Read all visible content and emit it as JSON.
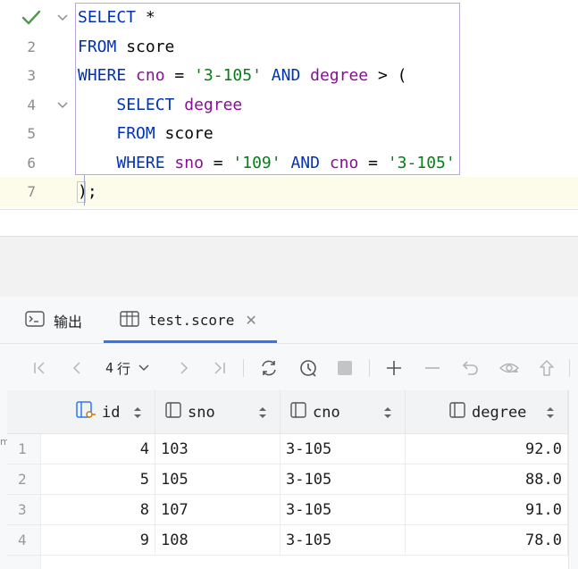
{
  "editor": {
    "line_numbers": [
      "",
      "2",
      "3",
      "4",
      "5",
      "6",
      "7"
    ],
    "lines": [
      [
        {
          "t": "SELECT",
          "c": "kw"
        },
        {
          "t": " *",
          "c": ""
        }
      ],
      [
        {
          "t": "FROM",
          "c": "kw"
        },
        {
          "t": " score",
          "c": ""
        }
      ],
      [
        {
          "t": "WHERE",
          "c": "kw"
        },
        {
          "t": " ",
          "c": ""
        },
        {
          "t": "cno",
          "c": "col"
        },
        {
          "t": " = ",
          "c": ""
        },
        {
          "t": "'3-105'",
          "c": "str"
        },
        {
          "t": " ",
          "c": ""
        },
        {
          "t": "AND",
          "c": "kw"
        },
        {
          "t": " ",
          "c": ""
        },
        {
          "t": "degree",
          "c": "col"
        },
        {
          "t": " > (",
          "c": ""
        }
      ],
      [
        {
          "t": "    ",
          "c": ""
        },
        {
          "t": "SELECT",
          "c": "kw"
        },
        {
          "t": " ",
          "c": ""
        },
        {
          "t": "degree",
          "c": "col"
        }
      ],
      [
        {
          "t": "    ",
          "c": ""
        },
        {
          "t": "FROM",
          "c": "kw"
        },
        {
          "t": " score",
          "c": ""
        }
      ],
      [
        {
          "t": "    ",
          "c": ""
        },
        {
          "t": "WHERE",
          "c": "kw"
        },
        {
          "t": " ",
          "c": ""
        },
        {
          "t": "sno",
          "c": "col"
        },
        {
          "t": " = ",
          "c": ""
        },
        {
          "t": "'109'",
          "c": "str"
        },
        {
          "t": " ",
          "c": ""
        },
        {
          "t": "AND",
          "c": "kw"
        },
        {
          "t": " ",
          "c": ""
        },
        {
          "t": "cno",
          "c": "col"
        },
        {
          "t": " = ",
          "c": ""
        },
        {
          "t": "'3-105'",
          "c": "str"
        }
      ],
      [
        {
          "t": ");",
          "c": ""
        }
      ]
    ]
  },
  "tabs": {
    "output_label": "输出",
    "table_label": "test.score"
  },
  "toolbar": {
    "rows_count": "4",
    "rows_unit": "行"
  },
  "grid": {
    "columns": [
      {
        "name": "id",
        "icon": "key-column-icon"
      },
      {
        "name": "sno",
        "icon": "column-icon"
      },
      {
        "name": "cno",
        "icon": "column-icon"
      },
      {
        "name": "degree",
        "icon": "column-icon"
      }
    ],
    "rows": [
      {
        "n": "1",
        "id": "4",
        "sno": "103",
        "cno": "3-105",
        "degree": "92.0"
      },
      {
        "n": "2",
        "id": "5",
        "sno": "105",
        "cno": "3-105",
        "degree": "88.0"
      },
      {
        "n": "3",
        "id": "8",
        "sno": "107",
        "cno": "3-105",
        "degree": "91.0"
      },
      {
        "n": "4",
        "id": "9",
        "sno": "108",
        "cno": "3-105",
        "degree": "78.0"
      }
    ]
  },
  "side_mark": "m",
  "colors": {
    "keyword": "#0033b3",
    "column": "#871094",
    "string": "#067d17",
    "accent": "#3574f0",
    "check": "#4e9a4e"
  }
}
